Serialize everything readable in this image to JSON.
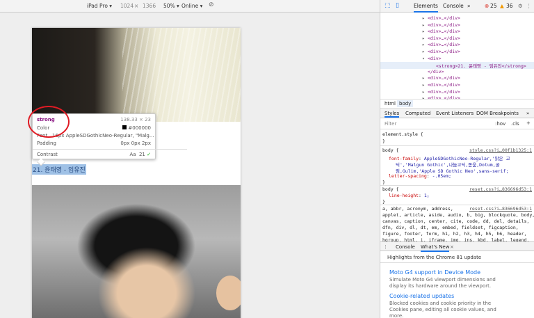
{
  "device_toolbar": {
    "device": "iPad Pro",
    "width": "1024",
    "sep": "×",
    "height": "1366",
    "zoom": "50%",
    "throttle": "Online"
  },
  "page": {
    "caption": "21. 윤태영 - 임유진"
  },
  "tooltip": {
    "tag": "strong",
    "size": "138.33 × 23",
    "color_label": "Color",
    "color_value": "#000000",
    "font_label": "Font",
    "font_value": "16px AppleSDGothicNeo-Regular, \"Malg...",
    "padding_label": "Padding",
    "padding_value": "0px 0px 2px",
    "contrast_label": "Contrast",
    "contrast_aa": "Aa",
    "contrast_value": "21"
  },
  "devtools": {
    "tabs": {
      "elements": "Elements",
      "console": "Console",
      "more": "»",
      "errors": "25",
      "warnings": "36"
    },
    "dom_lines": [
      "<div>…</div>",
      "<div>…</div>",
      "<div>…</div>",
      "<div>…</div>",
      "<div>…</div>",
      "<div>…</div>",
      "<div>",
      "<strong>21. 윤태영 - 임유진</strong>",
      "</div>",
      "<div>…</div>",
      "<div>…</div>",
      "<div>…</div>",
      "<div>…</div>"
    ],
    "breadcrumbs": [
      "html",
      "body"
    ],
    "styles_tabs": [
      "Styles",
      "Computed",
      "Event Listeners",
      "DOM Breakpoints"
    ],
    "styles_more": "»",
    "filter_placeholder": "Filter",
    "filter_hov": ":hov",
    "filter_cls": ".cls",
    "filter_plus": "+",
    "element_style": "element.style {",
    "close_brace": "}",
    "rule1": {
      "selector": "body {",
      "source": "style.css?i…00f1b1325:1",
      "prop1": "font-family",
      "val1": "AppleSDGothicNeo-Regular,'맑은 고",
      "val1b": "딕','Malgun Gothic',나눔고딕,돋움,Dotum,굴",
      "val1c": "림,Gulim,'Apple SD Gothic Neo',sans-serif;",
      "prop2": "letter-spacing",
      "val2": "-.05em;"
    },
    "rule2": {
      "selector": "body {",
      "source": "reset.css?i…836696d53:1",
      "prop1": "line-height",
      "val1": "1;"
    },
    "rule3": {
      "selector": "a, abbr, acronym, address,",
      "source": "reset.css?i…836696d53:1",
      "lines": [
        "applet, article, aside, audio, b, big, blockquote, body,",
        "canvas, caption, center, cite, code, dd, del, details,",
        "dfn, div, dl, dt, em, embed, fieldset, figcaption,",
        "figure, footer, form, h1, h2, h3, h4, h5, h6, header,",
        "hgroup, html, i, iframe, img, ins, kbd, label, legend,"
      ]
    },
    "drawer_tabs": {
      "console": "Console",
      "whatsnew": "What's New",
      "close": "×"
    },
    "whatsnew": {
      "highlight": "Highlights from the Chrome 81 update",
      "item1_title": "Moto G4 support in Device Mode",
      "item1_body": "Simulate Moto G4 viewport dimensions and display its hardware around the viewport.",
      "item2_title": "Cookie-related updates",
      "item2_body": "Blocked cookies and cookie priority in the Cookies pane, editing all cookie values, and more."
    }
  }
}
